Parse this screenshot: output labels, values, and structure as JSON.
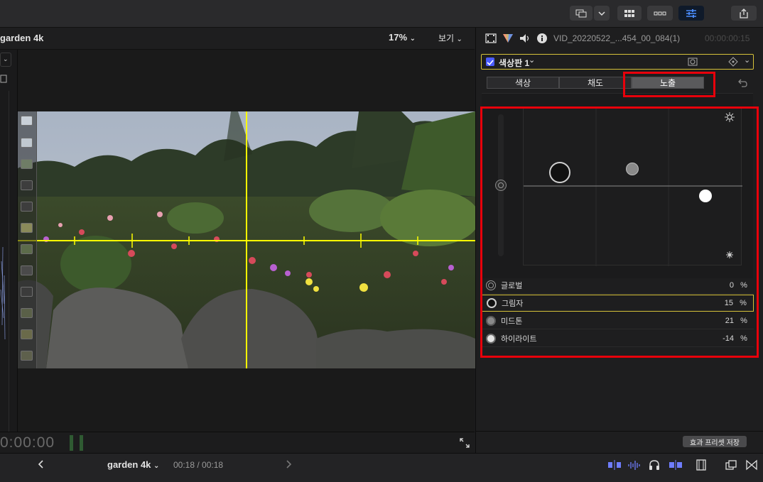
{
  "toolbar": {
    "share_icon": "share-icon"
  },
  "viewer": {
    "title": "garden 4k",
    "zoom": "17%",
    "view_menu": "보기",
    "timecode": "0:00:00"
  },
  "inspector": {
    "clip_name": "VID_20220522_...454_00_084(1)",
    "clip_time": "00:00:00:15",
    "board_name": "색상판 1",
    "tabs": [
      "색상",
      "채도",
      "노출"
    ],
    "active_tab": "노출",
    "controls": [
      {
        "label": "글로벌",
        "value": "0",
        "unit": "%"
      },
      {
        "label": "그림자",
        "value": "15",
        "unit": "%"
      },
      {
        "label": "미드톤",
        "value": "21",
        "unit": "%"
      },
      {
        "label": "하이라이트",
        "value": "-14",
        "unit": "%"
      }
    ],
    "save_preset": "효과 프리셋 저장"
  },
  "timeline": {
    "project": "garden 4k",
    "position": "00:18 / 00:18"
  },
  "colors": {
    "highlight_red": "#e8000b",
    "selected_yellow": "#d7c23a",
    "guide_yellow": "#ffff00"
  }
}
